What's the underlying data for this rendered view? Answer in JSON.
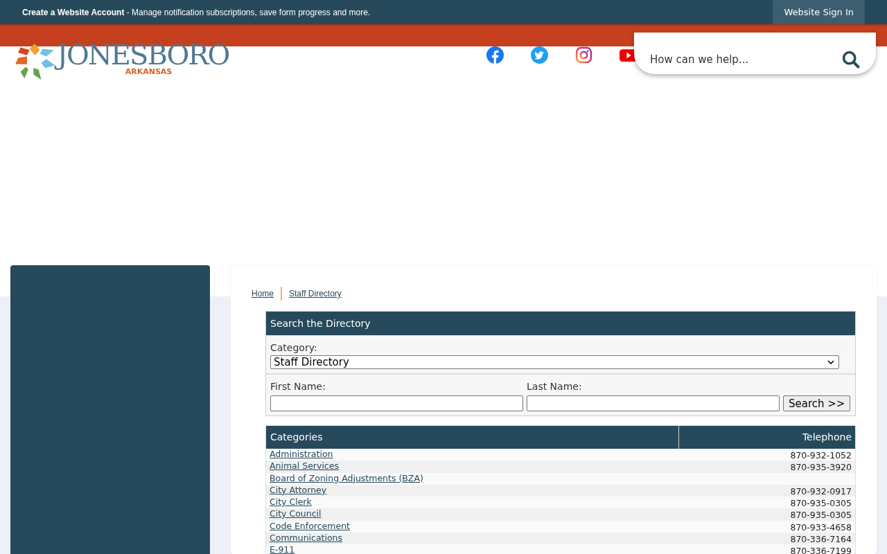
{
  "top_bar": {
    "account_link": "Create a Website Account",
    "account_note": " - Manage notification subscriptions, save form progress and more.",
    "sign_in": "Website Sign In"
  },
  "logo": {
    "name": "JONESBORO",
    "state": "ARKANSAS"
  },
  "social": [
    {
      "kind": "facebook"
    },
    {
      "kind": "twitter"
    },
    {
      "kind": "instagram"
    },
    {
      "kind": "youtube"
    }
  ],
  "search": {
    "placeholder": "How can we help..."
  },
  "breadcrumbs": [
    "Home",
    "Staff Directory"
  ],
  "directory_search": {
    "title": "Search the Directory",
    "category_label": "Category:",
    "category_value": "Staff Directory",
    "first_name_label": "First Name:",
    "last_name_label": "Last Name:",
    "button": "Search >>"
  },
  "table": {
    "columns": [
      "Categories",
      "Telephone"
    ],
    "rows": [
      {
        "name": "Administration",
        "phone": "870-932-1052"
      },
      {
        "name": "Animal Services",
        "phone": "870-935-3920"
      },
      {
        "name": "Board of Zoning Adjustments (BZA)"
      },
      {
        "name": "City Attorney",
        "phone": "870-932-0917"
      },
      {
        "name": "City Clerk",
        "phone": "870-935-0305"
      },
      {
        "name": "City Council",
        "phone": "870-935-0305"
      },
      {
        "name": "Code Enforcement",
        "phone": "870-933-4658"
      },
      {
        "name": "Communications",
        "phone": "870-336-7164"
      },
      {
        "name": "E-911",
        "phone": "870-336-7199"
      }
    ]
  }
}
